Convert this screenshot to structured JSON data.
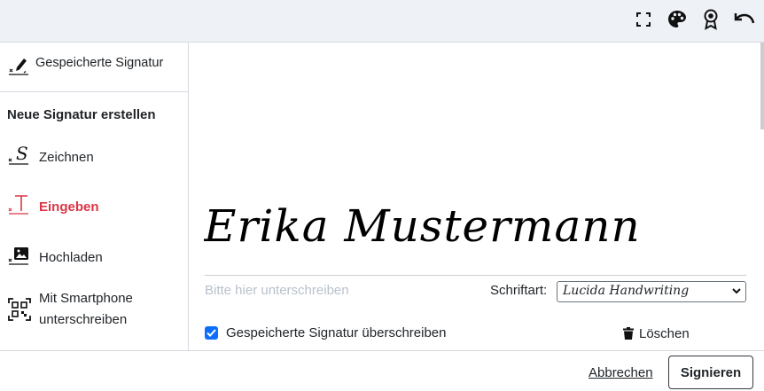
{
  "sidebar": {
    "saved": {
      "label": "Gespeicherte Signatur",
      "icon": "pen-signature-icon"
    },
    "section_title": "Neue Signatur erstellen",
    "items": [
      {
        "label": "Zeichnen",
        "icon": "draw-signature-icon"
      },
      {
        "label": "Eingeben",
        "icon": "type-text-icon",
        "active": true
      },
      {
        "label": "Hochladen",
        "icon": "image-upload-icon"
      },
      {
        "label_line1": "Mit Smartphone",
        "label_line2": "unterschreiben",
        "icon": "qr-code-icon"
      }
    ]
  },
  "toolbar": {
    "icons": [
      "fullscreen-icon",
      "palette-icon",
      "award-icon",
      "undo-icon"
    ]
  },
  "editor": {
    "signature_text": "Erika Mustermann",
    "placeholder": "Bitte hier unterschreiben",
    "font_label": "Schriftart:",
    "font_value": "Lucida Handwriting",
    "overwrite_label": "Gespeicherte Signatur überschreiben",
    "overwrite_checked": true,
    "delete_label": "Löschen"
  },
  "footer": {
    "cancel_label": "Abbrechen",
    "sign_label": "Signieren"
  },
  "colors": {
    "active": "#dc3545",
    "checkbox": "#0d6efd",
    "topbar": "#eef1f6"
  }
}
